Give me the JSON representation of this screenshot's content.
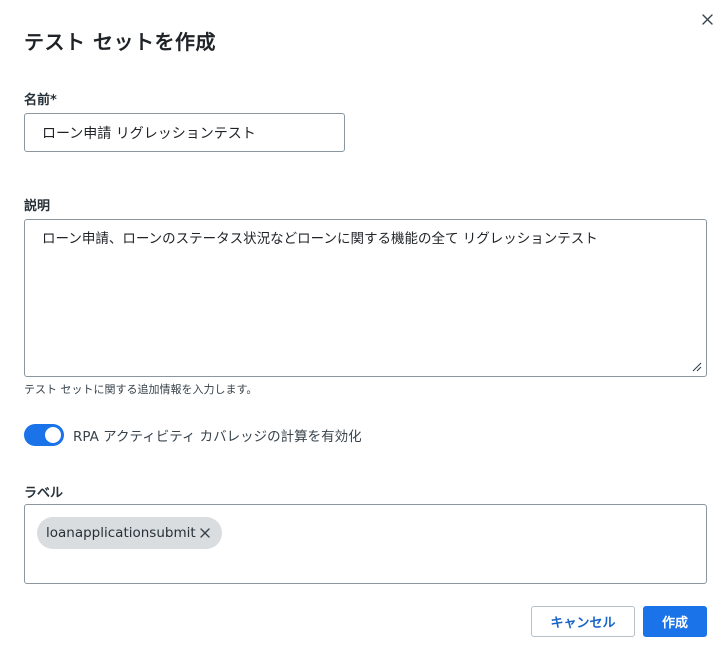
{
  "dialog": {
    "title": "テスト セットを作成",
    "close_icon": "close-icon"
  },
  "name_field": {
    "label": "名前*",
    "value": "ローン申請 リグレッションテスト"
  },
  "description_field": {
    "label": "説明",
    "value": "ローン申請、ローンのステータス状況などローンに関する機能の全て リグレッションテスト",
    "helper_text": "テスト セットに関する追加情報を入力します。"
  },
  "rpa_toggle": {
    "label": "RPA アクティビティ カバレッジの計算を有効化",
    "enabled": true,
    "color": "#1a73e8"
  },
  "labels_field": {
    "label": "ラベル",
    "tags": [
      {
        "text": "loanapplicationsubmit"
      }
    ]
  },
  "footer": {
    "cancel_label": "キャンセル",
    "create_label": "作成",
    "accent_color": "#1a73e8"
  }
}
